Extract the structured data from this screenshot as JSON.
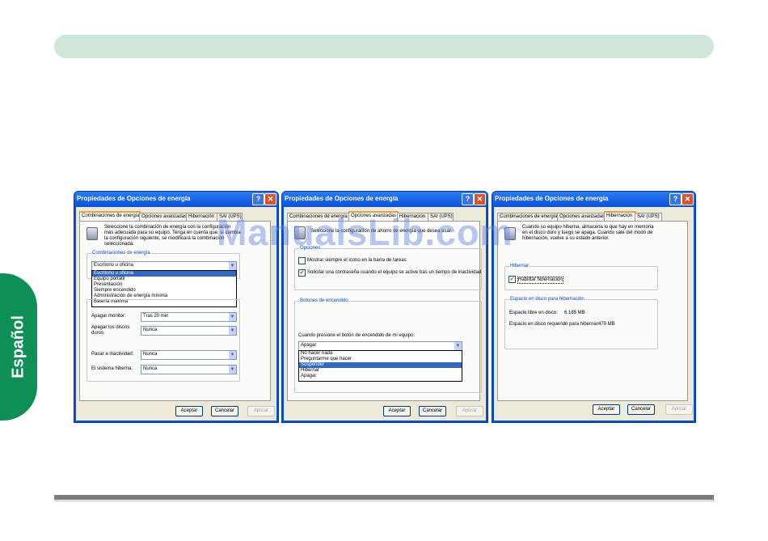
{
  "page": {
    "side_label": "Español",
    "watermark": "ManualsLib.com"
  },
  "colors": {
    "top_bar": "#cde6d8",
    "side_tab": "#0d8f55",
    "title_bar": "#0a52dc",
    "selection": "#316ac5"
  },
  "dialogs": [
    {
      "title": "Propiedades de Opciones de energía",
      "tabs": [
        "Combinaciones de energía",
        "Opciones avanzadas",
        "Hibernación",
        "SAI (UPS)"
      ],
      "active_tab": 0,
      "intro": [
        "Seleccione la combinación de energía con la configuración",
        "más adecuada para su equipo. Tenga en cuenta que, si cambia",
        "la configuración siguiente, se modificará la combinación",
        "seleccionada."
      ],
      "group_label": "Combinaciones de energía",
      "scheme_value": "Escritorio u oficina",
      "scheme_options": [
        "Escritorio u oficina",
        "Equipo portátil",
        "Presentación",
        "Siempre encendido",
        "Administración de energía mínima",
        "Batería máxima"
      ],
      "settings": [
        {
          "label": "Apagar monitor:",
          "value": "Tras 20 min"
        },
        {
          "label": "Apagar los discos duros:",
          "value": "Nunca"
        },
        {
          "label": "Pasar a inactividad:",
          "value": "Nunca"
        },
        {
          "label": "El sistema hiberna:",
          "value": "Nunca"
        }
      ],
      "buttons": [
        "Aceptar",
        "Cancelar",
        "Aplicar"
      ]
    },
    {
      "title": "Propiedades de Opciones de energía",
      "tabs": [
        "Combinaciones de energía",
        "Opciones avanzadas",
        "Hibernación",
        "SAI (UPS)"
      ],
      "active_tab": 1,
      "intro": "Seleccione la configuración de ahorro de energía que desea usar.",
      "options_label": "Opciones",
      "options": [
        {
          "label": "Mostrar siempre el icono en la barra de tareas",
          "checked": false
        },
        {
          "label": "Solicitar una contraseña cuando el equipo se active tras un tiempo de inactividad",
          "checked": true
        }
      ],
      "power_buttons_label": "Botones de encendido",
      "power_button_prompt": "Cuando presione el botón de encendido de mi equipo:",
      "power_button_value": "Apagar",
      "power_button_options": [
        "No hacer nada",
        "Preguntarme qué hacer",
        "Suspender",
        "Hibernar",
        "Apagar"
      ],
      "buttons": [
        "Aceptar",
        "Cancelar",
        "Aplicar"
      ]
    },
    {
      "title": "Propiedades de Opciones de energía",
      "tabs": [
        "Combinaciones de energía",
        "Opciones avanzadas",
        "Hibernación",
        "SAI (UPS)"
      ],
      "active_tab": 2,
      "intro": [
        "Cuando su equipo hiberna, almacena lo que hay en memoria",
        "en el disco duro y luego se apaga. Cuando sale del modo de",
        "hibernación, vuelve a su estado anterior."
      ],
      "hibernate_label": "Hibernar",
      "hibernate_checkbox": "Habilitar hibernación",
      "disk_label": "Espacio en disco para hibernación",
      "free_label": "Espacio libre en disco:",
      "free_value": "6.185 MB",
      "required_label": "Espacio en disco requerido para hibernar:",
      "required_value": "479 MB",
      "buttons": [
        "Aceptar",
        "Cancelar",
        "Aplicar"
      ]
    }
  ]
}
